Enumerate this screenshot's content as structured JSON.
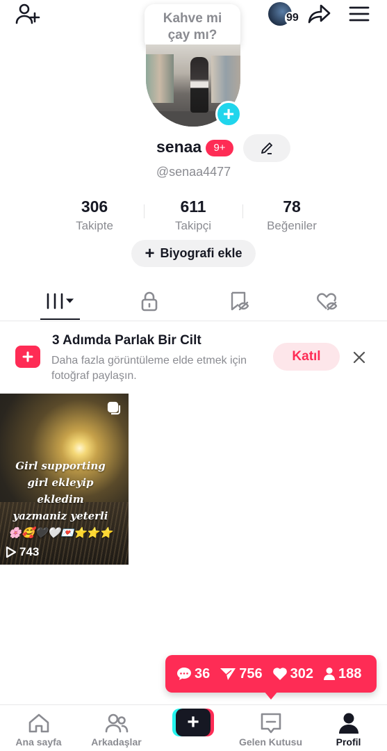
{
  "top_bubble": {
    "line1": "Kahve mi",
    "line2": "çay mı?"
  },
  "top_bar": {
    "story_count": "99",
    "icons": [
      "add-user-icon",
      "share-icon",
      "menu-icon"
    ]
  },
  "profile": {
    "username": "senaa",
    "notif_badge": "9+",
    "handle": "@senaa4477"
  },
  "stats": [
    {
      "value": "306",
      "label": "Takipte"
    },
    {
      "value": "611",
      "label": "Takipçi"
    },
    {
      "value": "78",
      "label": "Beğeniler"
    }
  ],
  "bio_button": {
    "plus": "+",
    "label": "Biyografi ekle"
  },
  "tabs": [
    "videos-grid-icon",
    "lock-icon",
    "bookmark-hidden-icon",
    "liked-hidden-icon"
  ],
  "promo": {
    "title": "3 Adımda Parlak Bir Cilt",
    "description": "Daha fazla görüntüleme elde etmek için fotoğraf paylaşın.",
    "join_label": "Katıl"
  },
  "video": {
    "caption": "Girl supporting girl ekleyip ekledim yazmaniz yeterli 🌸🥰🖤🤍💌⭐⭐⭐",
    "views": "743"
  },
  "activity_pill": {
    "comments": "36",
    "shares": "756",
    "likes": "302",
    "followers": "188"
  },
  "bottom_nav": [
    {
      "label": "Ana sayfa"
    },
    {
      "label": "Arkadaşlar"
    },
    {
      "label": "+"
    },
    {
      "label": "Gelen Kutusu"
    },
    {
      "label": "Profil"
    }
  ],
  "colors": {
    "accent": "#fe2c55",
    "cyan": "#20d5ec",
    "text": "#161823",
    "muted": "#8a8b91"
  }
}
